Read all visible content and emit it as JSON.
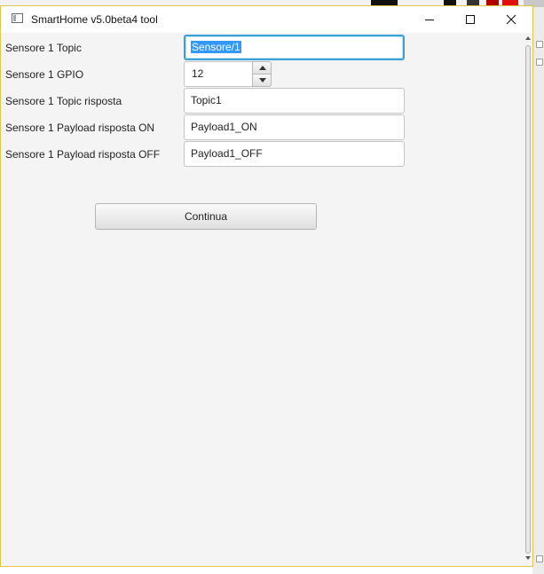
{
  "window": {
    "title": "SmartHome v5.0beta4 tool"
  },
  "form": {
    "topic_label": "Sensore 1 Topic",
    "topic_value": "Sensore/1",
    "gpio_label": "Sensore 1 GPIO",
    "gpio_value": "12",
    "topic_response_label": "Sensore 1 Topic risposta",
    "topic_response_value": "Topic1",
    "payload_on_label": "Sensore 1 Payload risposta ON",
    "payload_on_value": "Payload1_ON",
    "payload_off_label": "Sensore 1 Payload risposta OFF",
    "payload_off_value": "Payload1_OFF"
  },
  "actions": {
    "continue_label": "Continua"
  },
  "colors": {
    "focus_border": "#3aa0d8",
    "selection": "#3399ff",
    "window_border": "#e3c54a"
  }
}
